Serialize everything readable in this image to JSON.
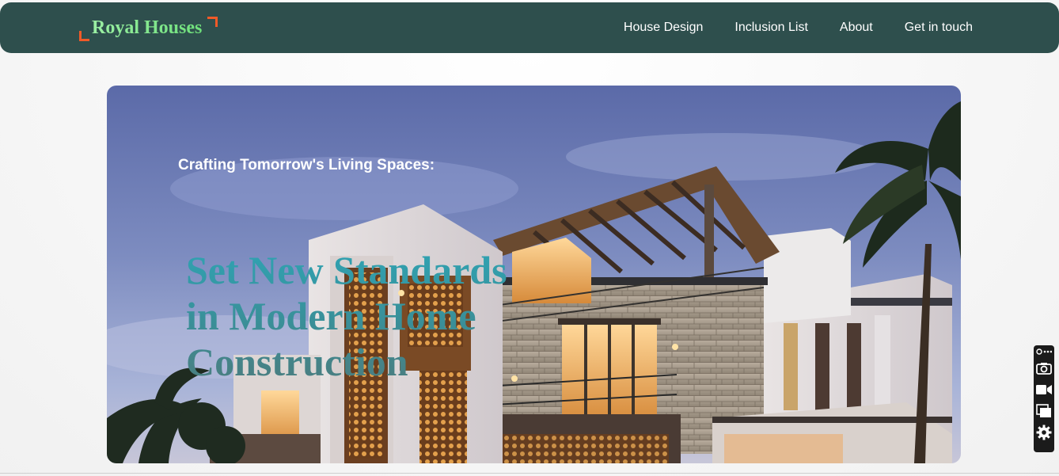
{
  "brand": {
    "name": "Royal Houses",
    "accent_color": "#f05a28",
    "nav_bg_color": "#2e4f4d"
  },
  "nav": {
    "items": [
      {
        "label": "House Design"
      },
      {
        "label": "Inclusion List"
      },
      {
        "label": "About"
      },
      {
        "label": "Get in touch"
      }
    ]
  },
  "hero": {
    "tagline": "Crafting Tomorrow's Living Spaces:",
    "heading": "Set New Standards in Modern Home Construction",
    "image": "modern-house-photo"
  },
  "widget": {
    "tools": [
      {
        "icon": "link-more-icon"
      },
      {
        "icon": "camera-icon"
      },
      {
        "icon": "video-camera-icon"
      },
      {
        "icon": "layers-icon"
      },
      {
        "icon": "gear-icon"
      }
    ]
  }
}
